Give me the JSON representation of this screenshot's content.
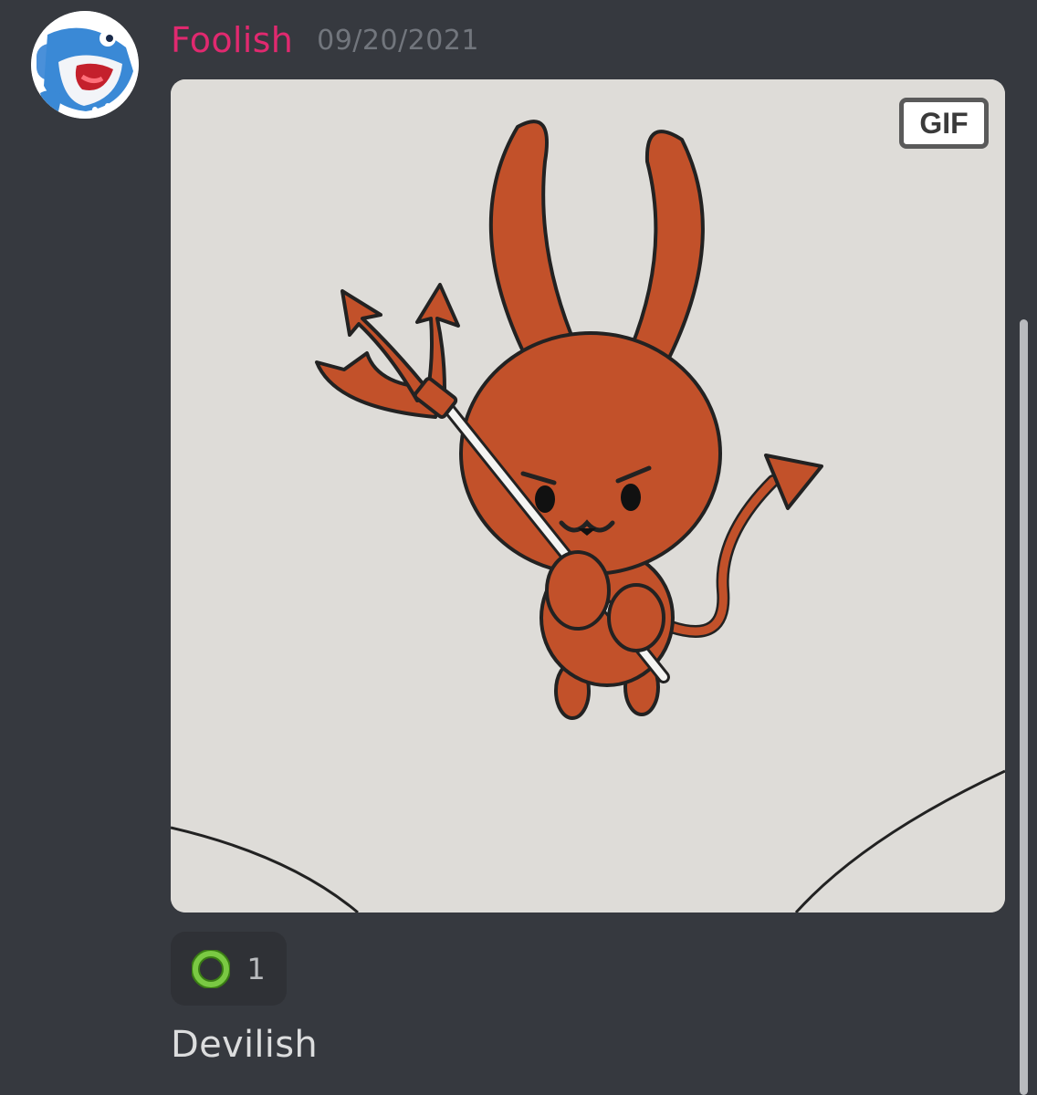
{
  "message": {
    "username": "Foolish",
    "timestamp": "09/20/2021",
    "username_color": "#e0296f",
    "avatar_icon": "shark-avatar-icon"
  },
  "attachment": {
    "type": "gif",
    "badge_label": "GIF",
    "artwork": "devil-bunny-trident-icon"
  },
  "reactions": [
    {
      "emoji": "green-ring-emoji-icon",
      "count": "1"
    }
  ],
  "content": {
    "text": "Devilish"
  },
  "theme": {
    "background": "#36393f",
    "reaction_bg": "#2f3136",
    "text": "#dcddde",
    "timestamp": "#72767d"
  }
}
